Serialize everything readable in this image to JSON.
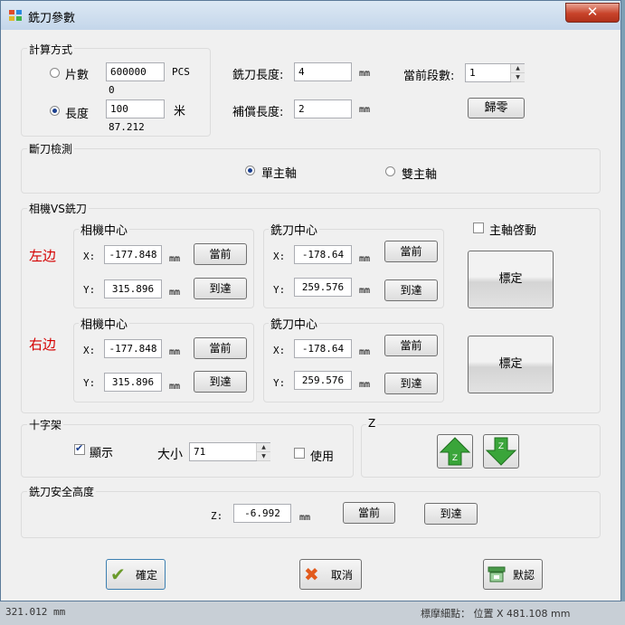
{
  "window": {
    "title": "銑刀參數",
    "close_symbol": "✕"
  },
  "calc_method": {
    "title": "計算方式",
    "pieces": {
      "label": "片數",
      "value": "600000",
      "unit": "PCS",
      "readout": "0",
      "selected": false
    },
    "length": {
      "label": "長度",
      "value": "100",
      "unit": "米",
      "readout": "87.212",
      "selected": true
    }
  },
  "cutter_length": {
    "label": "銑刀長度:",
    "value": "4",
    "unit": "mm"
  },
  "comp_length": {
    "label": "補償長度:",
    "value": "2",
    "unit": "mm"
  },
  "current_segment": {
    "label": "當前段數:",
    "value": "1"
  },
  "zero_button": "歸零",
  "break_detect": {
    "title": "斷刀檢測",
    "single": {
      "label": "單主軸",
      "selected": true
    },
    "double": {
      "label": "雙主軸",
      "selected": false
    }
  },
  "camera_vs_cutter": {
    "title": "相機VS銑刀",
    "spindle_start": {
      "label": "主軸啓動",
      "checked": false
    },
    "calibrate_label": "標定",
    "x_label": "X:",
    "y_label": "Y:",
    "unit": "mm",
    "current_label": "當前",
    "arrive_label": "到達",
    "camera_center_label": "相機中心",
    "cutter_center_label": "銑刀中心",
    "left": {
      "label": "左边",
      "camera": {
        "x": "-177.848",
        "y": "315.896"
      },
      "cutter": {
        "x": "-178.64",
        "y": "259.576"
      }
    },
    "right": {
      "label": "右边",
      "camera": {
        "x": "-177.848",
        "y": "315.896"
      },
      "cutter": {
        "x": "-178.64",
        "y": "259.576"
      }
    }
  },
  "crosshair": {
    "title": "十字架",
    "show": {
      "label": "顯示",
      "checked": true
    },
    "size": {
      "label": "大小",
      "value": "71"
    },
    "use": {
      "label": "使用",
      "checked": false
    }
  },
  "z_group": {
    "title": "Z",
    "up_icon_letter": "Z",
    "down_icon_letter": "Z"
  },
  "safe_height": {
    "title": "銑刀安全高度",
    "z_label": "Z:",
    "value": "-6.992",
    "unit": "mm",
    "current_label": "當前",
    "arrive_label": "到達"
  },
  "footer": {
    "ok": "確定",
    "cancel": "取消",
    "default": "默認"
  },
  "background": {
    "bottom_text": "321.012  mm",
    "bottom_right_text": "標摩細點：  位置  X  481.108 mm"
  }
}
